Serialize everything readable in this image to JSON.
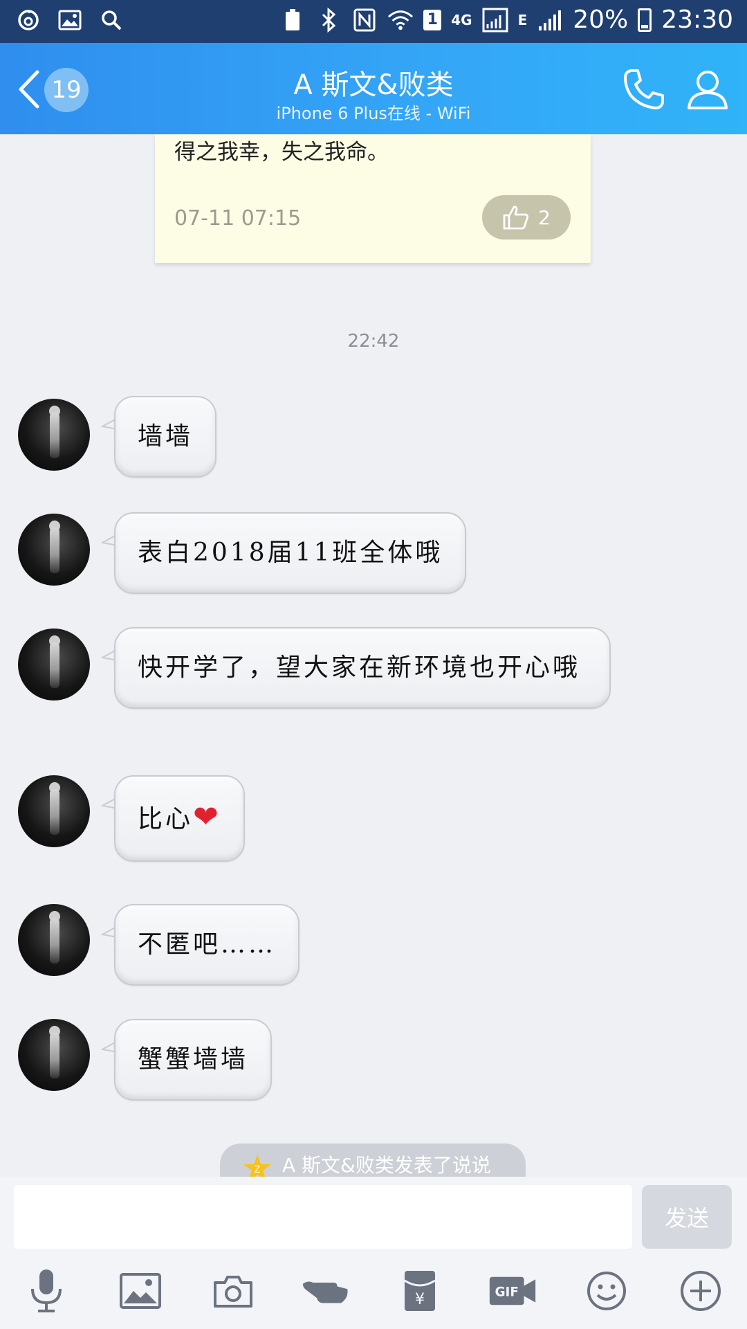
{
  "status_bar": {
    "network_label": "4G",
    "network2_label": "E",
    "sim_badge": "1",
    "battery": "20%",
    "time": "23:30"
  },
  "header": {
    "unread_count": "19",
    "title": "A 斯文&败类",
    "subtitle": "iPhone 6 Plus在线 - WiFi"
  },
  "note_card": {
    "text": "得之我幸，失之我命。",
    "time": "07-11 07:15",
    "likes": "2"
  },
  "time_divider": "22:42",
  "messages": [
    {
      "text": "墙墙"
    },
    {
      "text": "表白2018届11班全体哦"
    },
    {
      "text": "快开学了，望大家在新环境也开心哦"
    },
    {
      "text": "比心",
      "emoji": "❤"
    },
    {
      "text": "不匿吧……"
    },
    {
      "text": "蟹蟹墙墙"
    }
  ],
  "notification": "A 斯文&败类发表了说说",
  "input": {
    "placeholder": "",
    "send_label": "发送"
  },
  "toolbar_icons": [
    "microphone-icon",
    "image-icon",
    "camera-icon",
    "poke-icon",
    "red-packet-icon",
    "gif-icon",
    "emoji-icon",
    "plus-icon"
  ],
  "colors": {
    "header_start": "#2f8eee",
    "header_end": "#30b3f8",
    "status_bar": "#1f3f70",
    "background": "#eef0f4",
    "note_bg": "#fdfce4"
  }
}
